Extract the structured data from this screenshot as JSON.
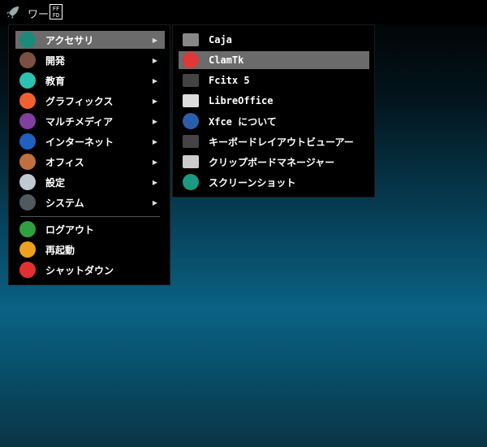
{
  "panel": {
    "workspace_label": "ワー",
    "ime_indicator": "FF FD"
  },
  "main_menu": {
    "items": [
      {
        "label": "アクセサリ",
        "icon": "accessories-icon",
        "color": "#1a8a7a",
        "submenu": true,
        "highlighted": true
      },
      {
        "label": "開発",
        "icon": "development-hammer-icon",
        "color": "#7a5040",
        "submenu": true
      },
      {
        "label": "教育",
        "icon": "education-icon",
        "color": "#2ec0b0",
        "submenu": true
      },
      {
        "label": "グラフィックス",
        "icon": "graphics-icon",
        "color": "#f06030",
        "submenu": true
      },
      {
        "label": "マルチメディア",
        "icon": "multimedia-icon",
        "color": "#8040a0",
        "submenu": true
      },
      {
        "label": "インターネット",
        "icon": "internet-icon",
        "color": "#2060c0",
        "submenu": true
      },
      {
        "label": "オフィス",
        "icon": "office-briefcase-icon",
        "color": "#c07040",
        "submenu": true
      },
      {
        "label": "設定",
        "icon": "settings-icon",
        "color": "#c0c8d0",
        "submenu": true
      },
      {
        "label": "システム",
        "icon": "system-gear-icon",
        "color": "#505860",
        "submenu": true
      }
    ],
    "session": [
      {
        "label": "ログアウト",
        "icon": "logout-icon",
        "color": "#30a040"
      },
      {
        "label": "再起動",
        "icon": "restart-icon",
        "color": "#f0a020"
      },
      {
        "label": "シャットダウン",
        "icon": "shutdown-icon",
        "color": "#e03030"
      }
    ]
  },
  "submenu": {
    "items": [
      {
        "label": "Caja",
        "icon": "caja-folder-icon",
        "color": "#888"
      },
      {
        "label": "ClamTk",
        "icon": "clamtk-icon",
        "color": "#e03838",
        "highlighted": true
      },
      {
        "label": "Fcitx 5",
        "icon": "keyboard-icon",
        "color": "#444"
      },
      {
        "label": "LibreOffice",
        "icon": "document-icon",
        "color": "#ddd"
      },
      {
        "label": "Xfce について",
        "icon": "xfce-mouse-icon",
        "color": "#2a5ea8"
      },
      {
        "label": "キーボードレイアウトビューアー",
        "icon": "keyboard-icon",
        "color": "#444"
      },
      {
        "label": "クリップボードマネージャー",
        "icon": "clipboard-icon",
        "color": "#ccc"
      },
      {
        "label": "スクリーンショット",
        "icon": "screenshot-icon",
        "color": "#1a9a80"
      }
    ]
  }
}
